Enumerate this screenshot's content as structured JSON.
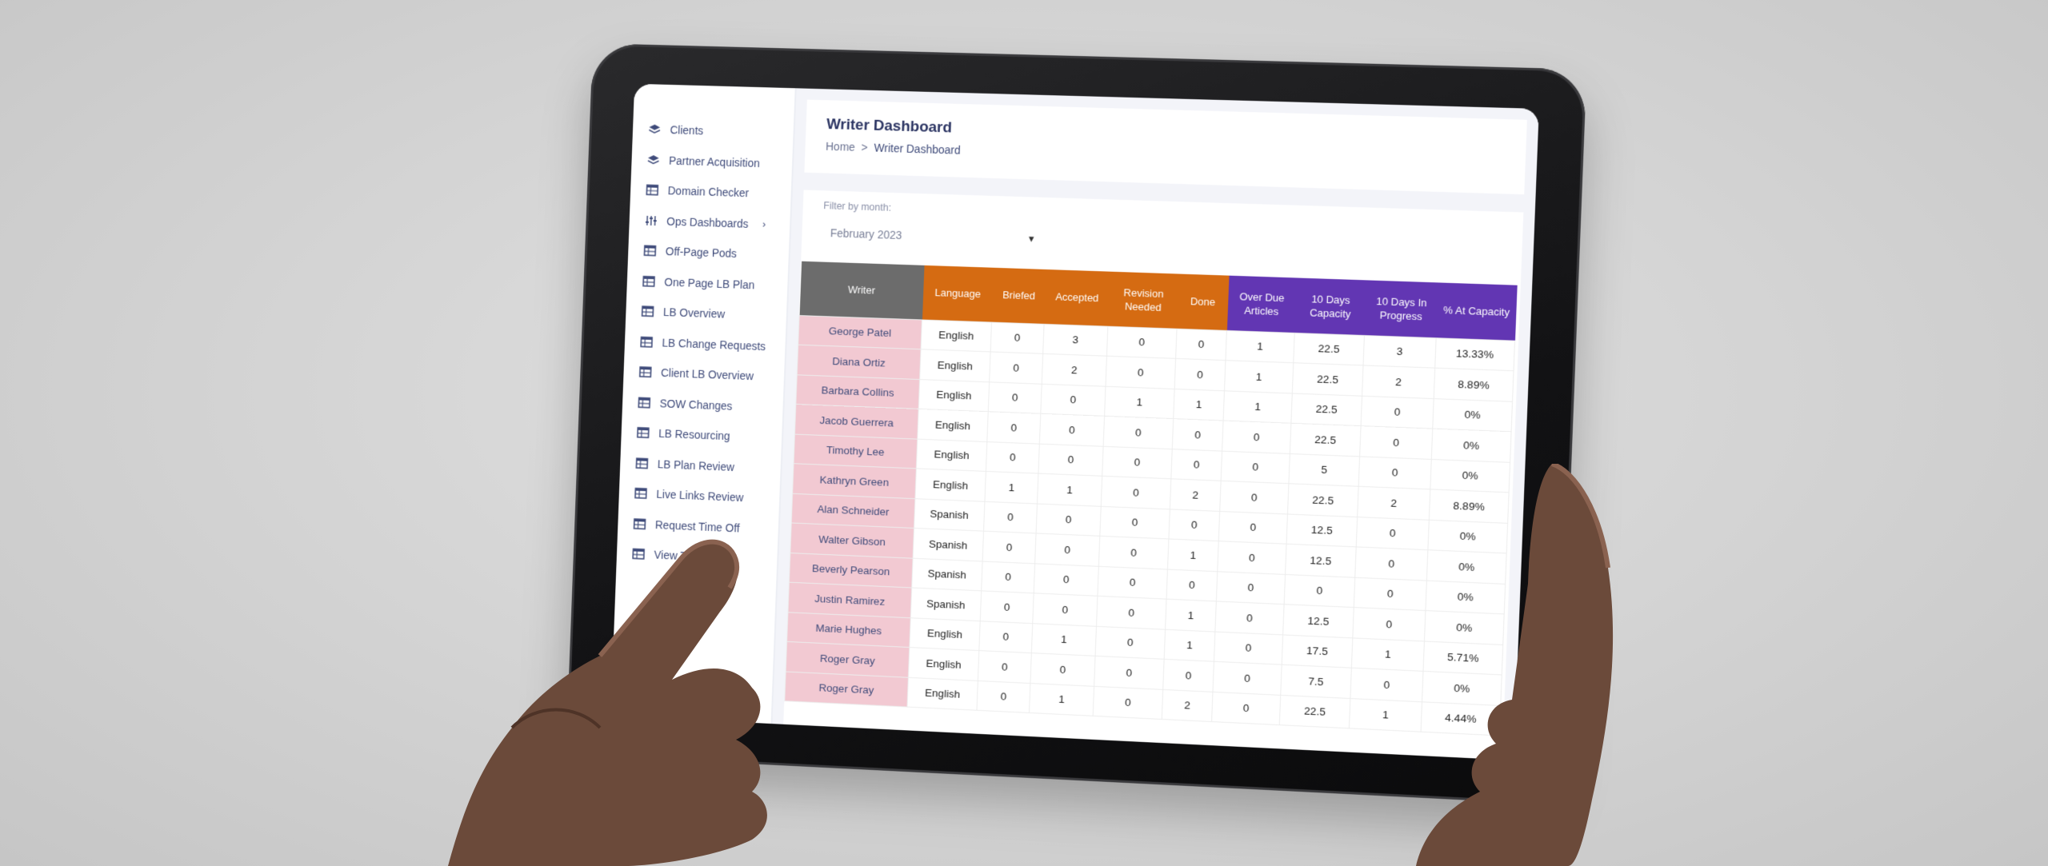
{
  "sidebar": {
    "items": [
      {
        "label": "Clients",
        "icon": "layers-icon"
      },
      {
        "label": "Partner Acquisition",
        "icon": "layers-icon"
      },
      {
        "label": "Domain Checker",
        "icon": "table-icon"
      },
      {
        "label": "Ops Dashboards",
        "icon": "sliders-icon",
        "chevron": "›"
      },
      {
        "label": "Off-Page Pods",
        "icon": "table-icon"
      },
      {
        "label": "One Page LB Plan",
        "icon": "table-icon"
      },
      {
        "label": "LB Overview",
        "icon": "table-icon"
      },
      {
        "label": "LB Change Requests",
        "icon": "table-icon"
      },
      {
        "label": "Client LB Overview",
        "icon": "table-icon"
      },
      {
        "label": "SOW Changes",
        "icon": "table-icon"
      },
      {
        "label": "LB Resourcing",
        "icon": "table-icon"
      },
      {
        "label": "LB Plan Review",
        "icon": "table-icon"
      },
      {
        "label": "Live Links Review",
        "icon": "table-icon"
      },
      {
        "label": "Request Time Off",
        "icon": "table-icon"
      },
      {
        "label": "View Time Off",
        "icon": "table-icon"
      }
    ]
  },
  "header": {
    "title": "Writer Dashboard",
    "breadcrumb": {
      "home": "Home",
      "separator": ">",
      "current": "Writer Dashboard"
    }
  },
  "filter": {
    "label": "Filter by month:",
    "selected": "February 2023"
  },
  "table": {
    "headers": {
      "writer": "Writer",
      "language": "Language",
      "briefed": "Briefed",
      "accepted": "Accepted",
      "revision_needed": "Revision Needed",
      "done": "Done",
      "over_due": "Over Due Articles",
      "capacity": "10 Days Capacity",
      "in_progress": "10 Days In Progress",
      "pct_capacity": "% At Capacity"
    },
    "rows": [
      {
        "writer": "George Patel",
        "language": "English",
        "briefed": "0",
        "accepted": "3",
        "revision": "0",
        "done": "0",
        "overdue": "1",
        "capacity": "22.5",
        "progress": "3",
        "pct": "13.33%"
      },
      {
        "writer": "Diana Ortiz",
        "language": "English",
        "briefed": "0",
        "accepted": "2",
        "revision": "0",
        "done": "0",
        "overdue": "1",
        "capacity": "22.5",
        "progress": "2",
        "pct": "8.89%"
      },
      {
        "writer": "Barbara Collins",
        "language": "English",
        "briefed": "0",
        "accepted": "0",
        "revision": "1",
        "done": "1",
        "overdue": "1",
        "capacity": "22.5",
        "progress": "0",
        "pct": "0%"
      },
      {
        "writer": "Jacob Guerrera",
        "language": "English",
        "briefed": "0",
        "accepted": "0",
        "revision": "0",
        "done": "0",
        "overdue": "0",
        "capacity": "22.5",
        "progress": "0",
        "pct": "0%"
      },
      {
        "writer": "Timothy Lee",
        "language": "English",
        "briefed": "0",
        "accepted": "0",
        "revision": "0",
        "done": "0",
        "overdue": "0",
        "capacity": "5",
        "progress": "0",
        "pct": "0%"
      },
      {
        "writer": "Kathryn Green",
        "language": "English",
        "briefed": "1",
        "accepted": "1",
        "revision": "0",
        "done": "2",
        "overdue": "0",
        "capacity": "22.5",
        "progress": "2",
        "pct": "8.89%"
      },
      {
        "writer": "Alan Schneider",
        "language": "Spanish",
        "briefed": "0",
        "accepted": "0",
        "revision": "0",
        "done": "0",
        "overdue": "0",
        "capacity": "12.5",
        "progress": "0",
        "pct": "0%"
      },
      {
        "writer": "Walter Gibson",
        "language": "Spanish",
        "briefed": "0",
        "accepted": "0",
        "revision": "0",
        "done": "1",
        "overdue": "0",
        "capacity": "12.5",
        "progress": "0",
        "pct": "0%"
      },
      {
        "writer": "Beverly Pearson",
        "language": "Spanish",
        "briefed": "0",
        "accepted": "0",
        "revision": "0",
        "done": "0",
        "overdue": "0",
        "capacity": "0",
        "progress": "0",
        "pct": "0%"
      },
      {
        "writer": "Justin Ramirez",
        "language": "Spanish",
        "briefed": "0",
        "accepted": "0",
        "revision": "0",
        "done": "1",
        "overdue": "0",
        "capacity": "12.5",
        "progress": "0",
        "pct": "0%"
      },
      {
        "writer": "Marie Hughes",
        "language": "English",
        "briefed": "0",
        "accepted": "1",
        "revision": "0",
        "done": "1",
        "overdue": "0",
        "capacity": "17.5",
        "progress": "1",
        "pct": "5.71%"
      },
      {
        "writer": "Roger Gray",
        "language": "English",
        "briefed": "0",
        "accepted": "0",
        "revision": "0",
        "done": "0",
        "overdue": "0",
        "capacity": "7.5",
        "progress": "0",
        "pct": "0%"
      },
      {
        "writer": "Roger Gray",
        "language": "English",
        "briefed": "0",
        "accepted": "1",
        "revision": "0",
        "done": "2",
        "overdue": "0",
        "capacity": "22.5",
        "progress": "1",
        "pct": "4.44%"
      }
    ]
  },
  "colors": {
    "writer_header": "#6c6c6c",
    "orange_header": "#d56b12",
    "purple_header": "#6236b3",
    "writer_column": "#f2c9d2",
    "nav_text": "#3f4b7a"
  }
}
